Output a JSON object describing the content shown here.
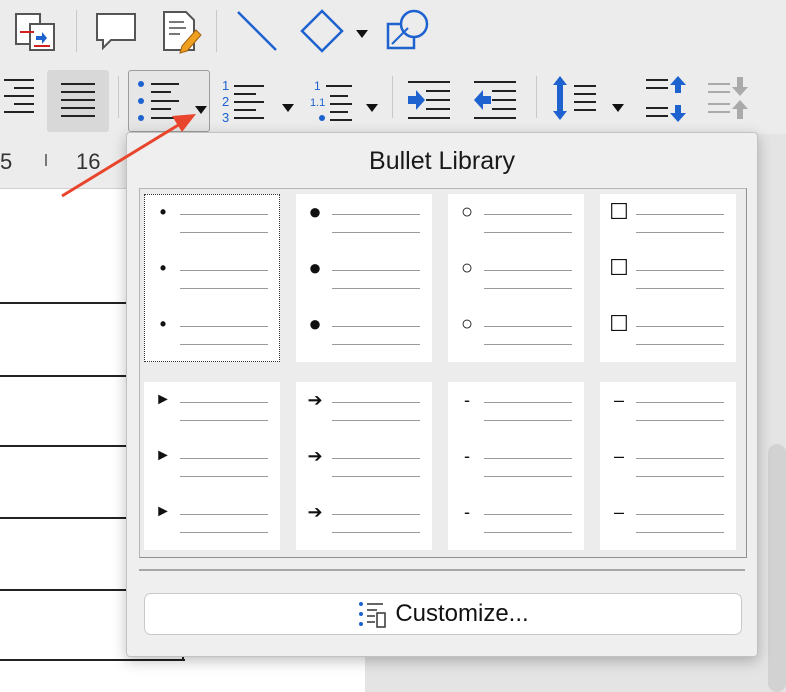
{
  "ruler": {
    "left_number": "5",
    "right_number": "16"
  },
  "bullet_library": {
    "title": "Bullet Library",
    "cells": [
      {
        "symbol": "•",
        "name": "small-dot"
      },
      {
        "symbol": "●",
        "name": "filled-circle"
      },
      {
        "symbol": "○",
        "name": "hollow-circle"
      },
      {
        "symbol": "☐",
        "name": "hollow-square"
      },
      {
        "symbol": "►",
        "name": "triangle-arrow"
      },
      {
        "symbol": "➔",
        "name": "right-arrow"
      },
      {
        "symbol": "-",
        "name": "hyphen"
      },
      {
        "symbol": "–",
        "name": "en-dash"
      }
    ],
    "customize_label": "Customize..."
  },
  "colors": {
    "accent_blue": "#1e62d0",
    "annotation_arrow": "#e8452c"
  }
}
